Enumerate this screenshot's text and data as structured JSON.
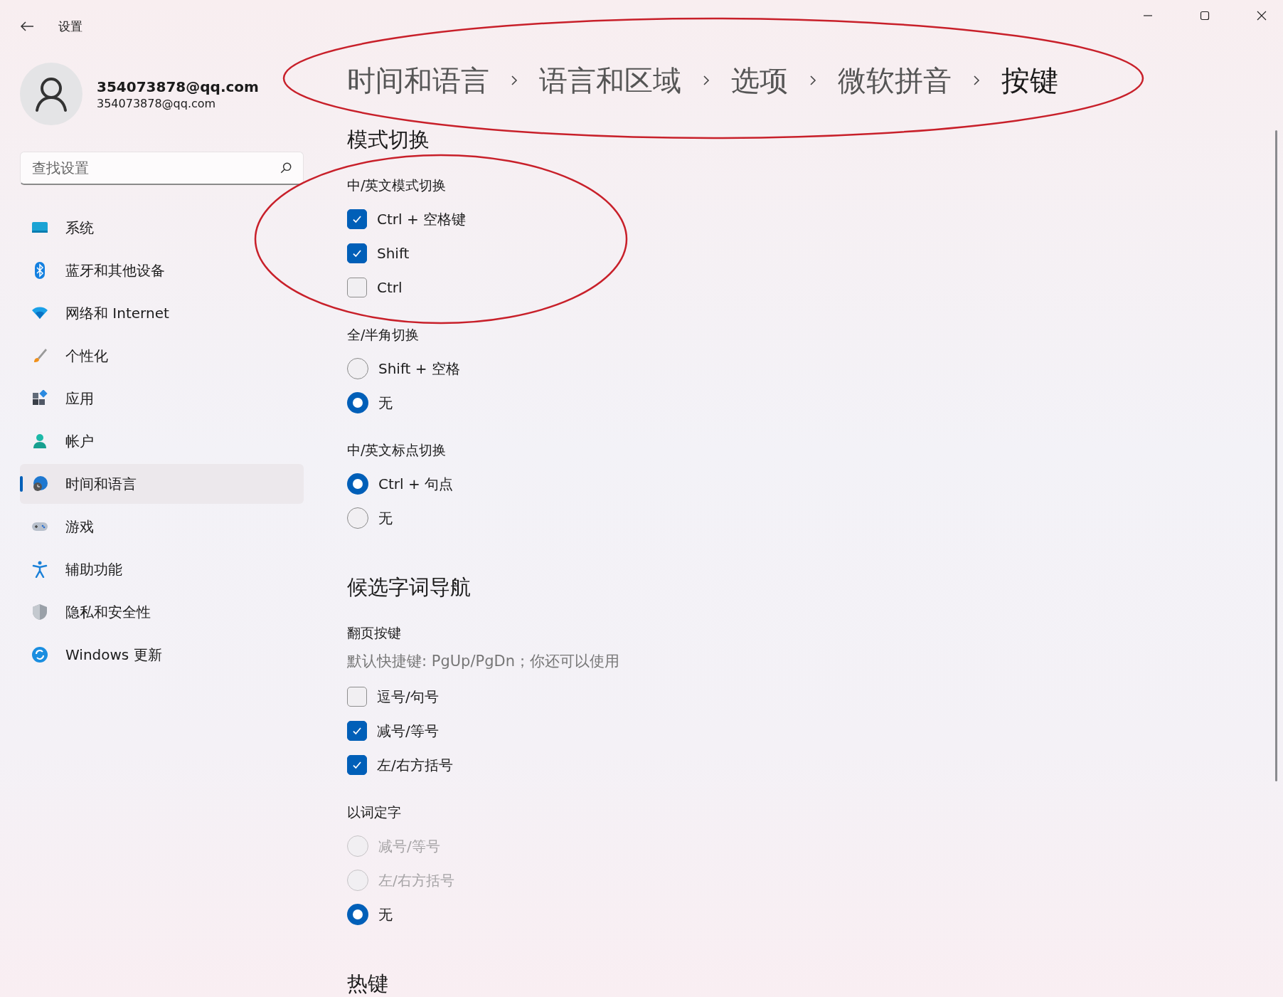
{
  "window": {
    "title": "设置"
  },
  "account": {
    "name": "354073878@qq.com",
    "email": "354073878@qq.com"
  },
  "search": {
    "placeholder": "查找设置"
  },
  "sidebar": {
    "items": [
      {
        "label": "系统",
        "selected": false
      },
      {
        "label": "蓝牙和其他设备",
        "selected": false
      },
      {
        "label": "网络和 Internet",
        "selected": false
      },
      {
        "label": "个性化",
        "selected": false
      },
      {
        "label": "应用",
        "selected": false
      },
      {
        "label": "帐户",
        "selected": false
      },
      {
        "label": "时间和语言",
        "selected": true
      },
      {
        "label": "游戏",
        "selected": false
      },
      {
        "label": "辅助功能",
        "selected": false
      },
      {
        "label": "隐私和安全性",
        "selected": false
      },
      {
        "label": "Windows 更新",
        "selected": false
      }
    ]
  },
  "breadcrumb": [
    {
      "label": "时间和语言",
      "current": false
    },
    {
      "label": "语言和区域",
      "current": false
    },
    {
      "label": "选项",
      "current": false
    },
    {
      "label": "微软拼音",
      "current": false
    },
    {
      "label": "按键",
      "current": true
    }
  ],
  "sections": [
    {
      "title": "模式切换",
      "groups": [
        {
          "label": "中/英文模式切换",
          "options": [
            {
              "kind": "checkbox",
              "label": "Ctrl + 空格键",
              "checked": true,
              "disabled": false
            },
            {
              "kind": "checkbox",
              "label": "Shift",
              "checked": true,
              "disabled": false
            },
            {
              "kind": "checkbox",
              "label": "Ctrl",
              "checked": false,
              "disabled": false
            }
          ]
        },
        {
          "label": "全/半角切换",
          "options": [
            {
              "kind": "radio",
              "label": "Shift + 空格",
              "selected": false,
              "disabled": false
            },
            {
              "kind": "radio",
              "label": "无",
              "selected": true,
              "disabled": false
            }
          ]
        },
        {
          "label": "中/英文标点切换",
          "options": [
            {
              "kind": "radio",
              "label": "Ctrl + 句点",
              "selected": true,
              "disabled": false
            },
            {
              "kind": "radio",
              "label": "无",
              "selected": false,
              "disabled": false
            }
          ]
        }
      ]
    },
    {
      "title": "候选字词导航",
      "groups": [
        {
          "label": "翻页按键",
          "description": "默认快捷键: PgUp/PgDn；你还可以使用",
          "options": [
            {
              "kind": "checkbox",
              "label": "逗号/句号",
              "checked": false,
              "disabled": false
            },
            {
              "kind": "checkbox",
              "label": "减号/等号",
              "checked": true,
              "disabled": false
            },
            {
              "kind": "checkbox",
              "label": "左/右方括号",
              "checked": true,
              "disabled": false
            }
          ]
        },
        {
          "label": "以词定字",
          "options": [
            {
              "kind": "radio",
              "label": "减号/等号",
              "selected": false,
              "disabled": true
            },
            {
              "kind": "radio",
              "label": "左/右方括号",
              "selected": false,
              "disabled": true
            },
            {
              "kind": "radio",
              "label": "无",
              "selected": true,
              "disabled": false
            }
          ]
        }
      ]
    },
    {
      "title": "热键"
    }
  ]
}
